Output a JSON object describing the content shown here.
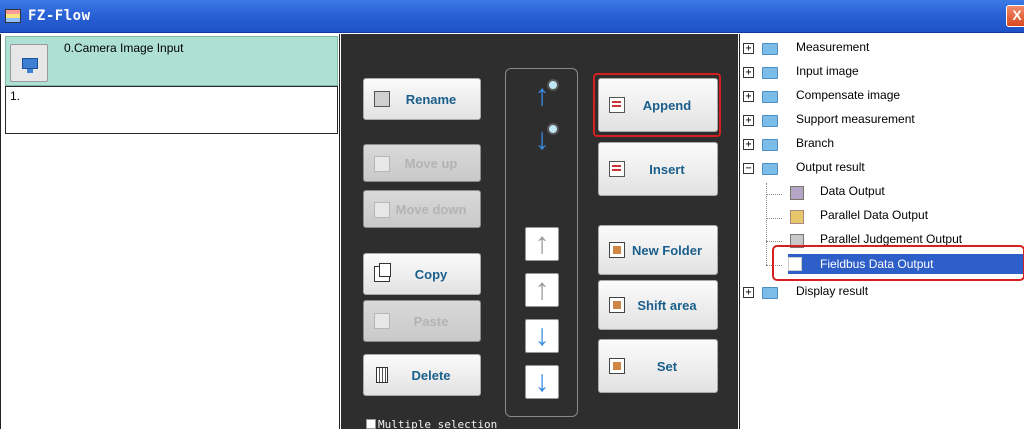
{
  "window": {
    "title": "FZ-Flow",
    "close_glyph": "X",
    "app_icon": "app-icon"
  },
  "flow": {
    "items": [
      {
        "label": "0.Camera Image Input",
        "icon": "camera-icon",
        "selected": true
      },
      {
        "label": "1.",
        "selected": false
      }
    ]
  },
  "buttons": {
    "rename": "Rename",
    "move_up": "Move up",
    "move_down": "Move down",
    "copy": "Copy",
    "paste": "Paste",
    "delete": "Delete",
    "append": "Append",
    "insert": "Insert",
    "new_folder": "New Folder",
    "shift_area": "Shift area",
    "set": "Set"
  },
  "arrows": {
    "item_up": "↑",
    "item_down": "↓",
    "top": "↑",
    "up": "↑",
    "down": "↓",
    "bottom": "↓"
  },
  "multiple_selection": {
    "label": "Multiple selection",
    "checked": false
  },
  "tree": {
    "nodes": [
      {
        "label": "Measurement",
        "expander": "+"
      },
      {
        "label": "Input image",
        "expander": "+"
      },
      {
        "label": "Compensate image",
        "expander": "+"
      },
      {
        "label": "Support measurement",
        "expander": "+"
      },
      {
        "label": "Branch",
        "expander": "+"
      },
      {
        "label": "Output result",
        "expander": "−",
        "children": [
          {
            "label": "Data Output",
            "icon": "data-output-icon"
          },
          {
            "label": "Parallel Data Output",
            "icon": "parallel-data-output-icon"
          },
          {
            "label": "Parallel Judgement Output",
            "icon": "parallel-judgement-icon"
          },
          {
            "label": "Fieldbus Data Output",
            "icon": "fieldbus-icon",
            "selected": true
          }
        ]
      },
      {
        "label": "Display result",
        "expander": "+"
      }
    ]
  },
  "colors": {
    "selection": "#2e5fc8",
    "highlight": "#d42020",
    "button_text": "#1a5f8c",
    "flow_selected": "#aee0d4"
  }
}
